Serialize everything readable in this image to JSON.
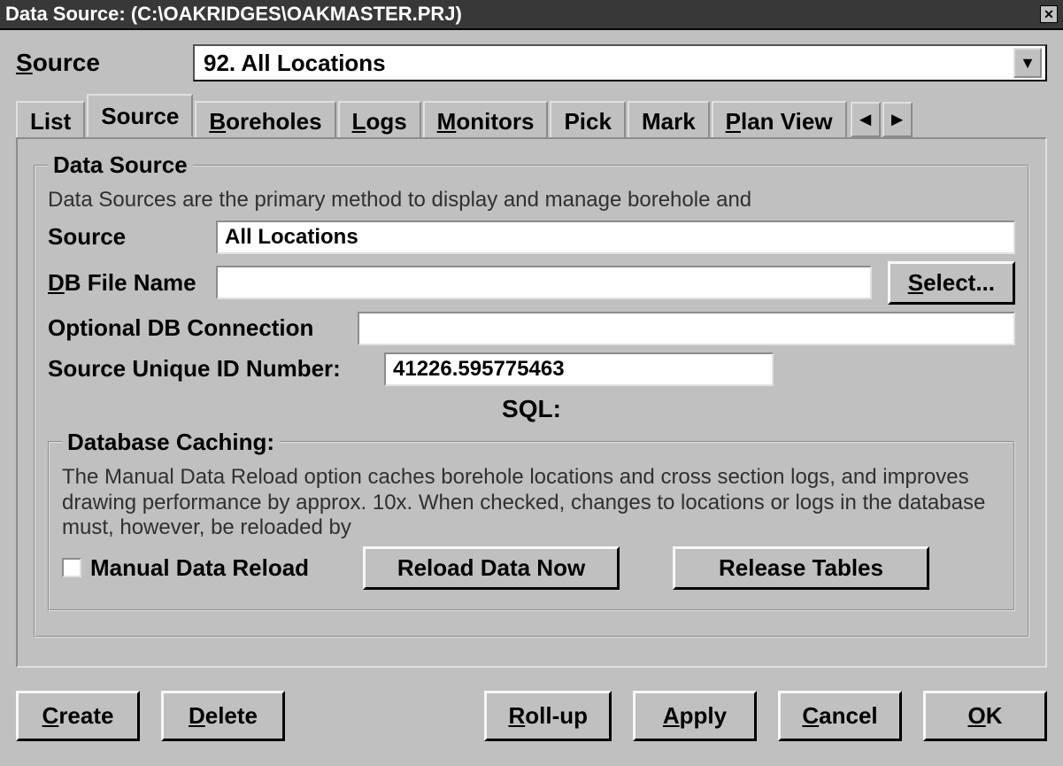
{
  "title": "Data Source: (C:\\OAKRIDGES\\OAKMASTER.PRJ)",
  "close_glyph": "✕",
  "source_label": "Source",
  "source_combo": "92. All Locations",
  "combo_arrow": "▼",
  "tabs": [
    "List",
    "Source",
    "Boreholes",
    "Logs",
    "Monitors",
    "Pick",
    "Mark",
    "Plan View"
  ],
  "tab_scroll_left": "◄",
  "tab_scroll_right": "►",
  "ds": {
    "legend": "Data Source",
    "desc": "Data Sources are the primary method to display and manage borehole and",
    "source_lbl": "Source",
    "source_val": "All Locations",
    "dbfile_lbl": "DB File Name",
    "dbfile_val": "",
    "select_btn": "Select...",
    "optconn_lbl": "Optional DB Connection",
    "optconn_val": "",
    "uid_lbl": "Source Unique ID Number:",
    "uid_val": "41226.595775463",
    "sql_lbl": "SQL:"
  },
  "cache": {
    "legend": "Database Caching:",
    "desc": "The Manual Data Reload option caches borehole locations and cross section logs, and improves drawing performance by approx. 10x. When checked, changes to locations or logs in the database must, however, be reloaded by",
    "manual_lbl": "Manual Data Reload",
    "reload_btn": "Reload Data Now",
    "release_btn": "Release Tables"
  },
  "btns": {
    "create": "Create",
    "delete": "Delete",
    "rollup": "Roll-up",
    "apply": "Apply",
    "cancel": "Cancel",
    "ok": "OK"
  }
}
